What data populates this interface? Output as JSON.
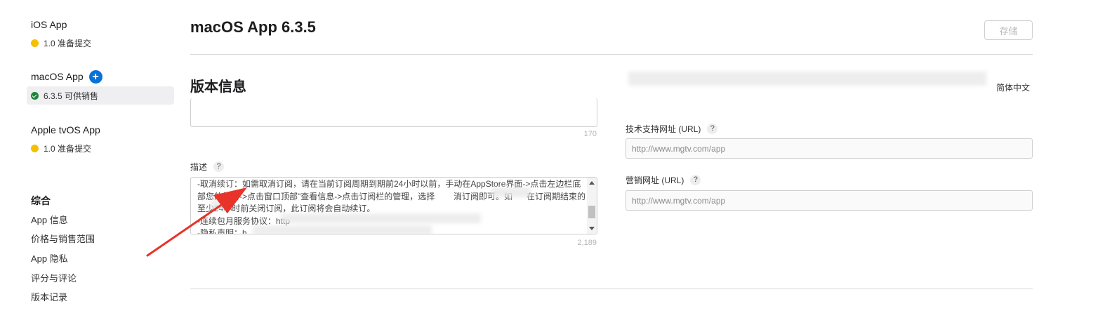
{
  "sidebar": {
    "platforms": [
      {
        "title": "iOS App",
        "version": "1.0 准备提交",
        "status": "yellow"
      },
      {
        "title": "macOS App",
        "version": "6.3.5 可供销售",
        "status": "green",
        "add_label": "+"
      },
      {
        "title": "Apple tvOS App",
        "version": "1.0 准备提交",
        "status": "yellow"
      }
    ],
    "section_heading": "综合",
    "nav_items": [
      "App 信息",
      "价格与销售范围",
      "App 隐私",
      "评分与评论",
      "版本记录"
    ]
  },
  "header": {
    "title": "macOS App 6.3.5",
    "save_label": "存储"
  },
  "version_info": {
    "title": "版本信息",
    "language": "简体中文",
    "promo_counter": "170",
    "description": {
      "label": "描述",
      "help": "?",
      "text": "-取消续订：如需取消订阅，请在当前订阅周期到期前24小时以前，手动在AppStore界面->点击左边栏底部您的姓名->点击窗口顶部\"查看信息->点击订阅栏的管理，选择        消订阅即可。如      在订阅期结束的至少24小时前关闭订阅，此订阅将会自动续订。\n-连续包月服务协议：http\n-隐私声明：h",
      "counter": "2,189"
    },
    "support_url": {
      "label": "技术支持网址 (URL)",
      "help": "?",
      "value": "http://www.mgtv.com/app"
    },
    "marketing_url": {
      "label": "营销网址 (URL)",
      "help": "?",
      "value": "http://www.mgtv.com/app"
    }
  },
  "colors": {
    "accent": "#0a72d6",
    "status_ready": "#17863a",
    "status_pending": "#f6c000",
    "annotation_arrow": "#e8332a"
  }
}
